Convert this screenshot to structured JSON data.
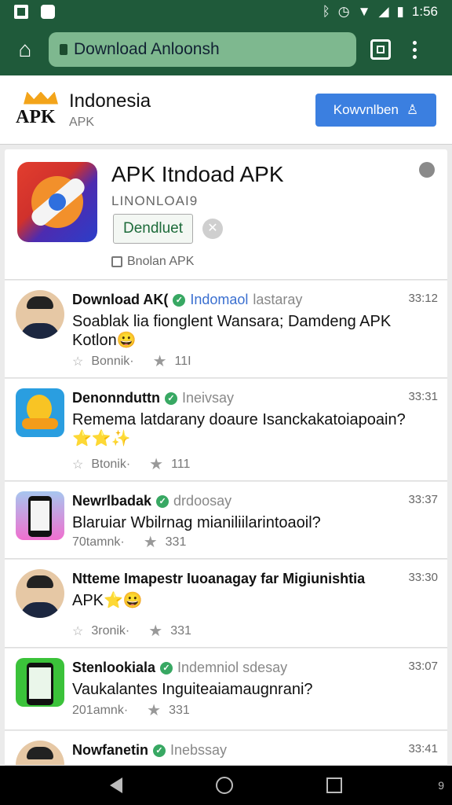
{
  "status_bar": {
    "time": "1:56",
    "icons": [
      "image-icon",
      "file-icon",
      "bluetooth-icon",
      "alarm-icon",
      "wifi-icon",
      "signal-icon",
      "battery-icon"
    ]
  },
  "browser": {
    "url": "Download Anloonsh",
    "tabs_icon": "tabs-icon",
    "menu_icon": "more-vert-icon"
  },
  "site": {
    "title": "Indonesia",
    "subtitle": "APK",
    "logo_text": "APK",
    "download_label": "Kowvnlben"
  },
  "app": {
    "title": "APK Itndoad APK",
    "subtitle": "LINONLOAI9",
    "install_label": "Dendluet",
    "rating_text": "Bnolan APK"
  },
  "posts": [
    {
      "author": "Download AK(",
      "tag": "Indomaol",
      "tag2": "lastaray",
      "time": "33:12",
      "body": "Soablak lia fionglent Wansara; Damdeng APK Kotlon😀",
      "stat1": "Bonnik·",
      "stat2": "11I"
    },
    {
      "author": "Denonnduttn",
      "tag": "",
      "tag2": "Ineivsay",
      "time": "33:31",
      "body": "Remema latdarany doaure Isanckakatoiapoain? ⭐⭐✨",
      "stat1": "Btonik·",
      "stat2": "111"
    },
    {
      "author": "Newrlbadak",
      "tag": "",
      "tag2": "drdoosay",
      "time": "33:37",
      "body": "Blaruiar Wbilrnag mianiliilarintoaoil?",
      "stat1": "70tamnk·",
      "stat2": "331"
    },
    {
      "author": "Ntteme Imapestr Iuoanagay far Migiunishtia",
      "tag": "",
      "tag2": "",
      "time": "33:30",
      "body": "APK⭐😀",
      "stat1": "3ronik·",
      "stat2": "331"
    },
    {
      "author": "Stenlookiala",
      "tag": "",
      "tag2": "Indemniol sdesay",
      "time": "33:07",
      "body": "Vaukalantes Inguiteaiamaugnrani?",
      "stat1": "201amnk·",
      "stat2": "331"
    },
    {
      "author": "Nowfanetin",
      "tag": "",
      "tag2": "Inebssay",
      "time": "33:41",
      "body": "",
      "stat1": "",
      "stat2": ""
    }
  ],
  "nav": {
    "extra": "9"
  }
}
